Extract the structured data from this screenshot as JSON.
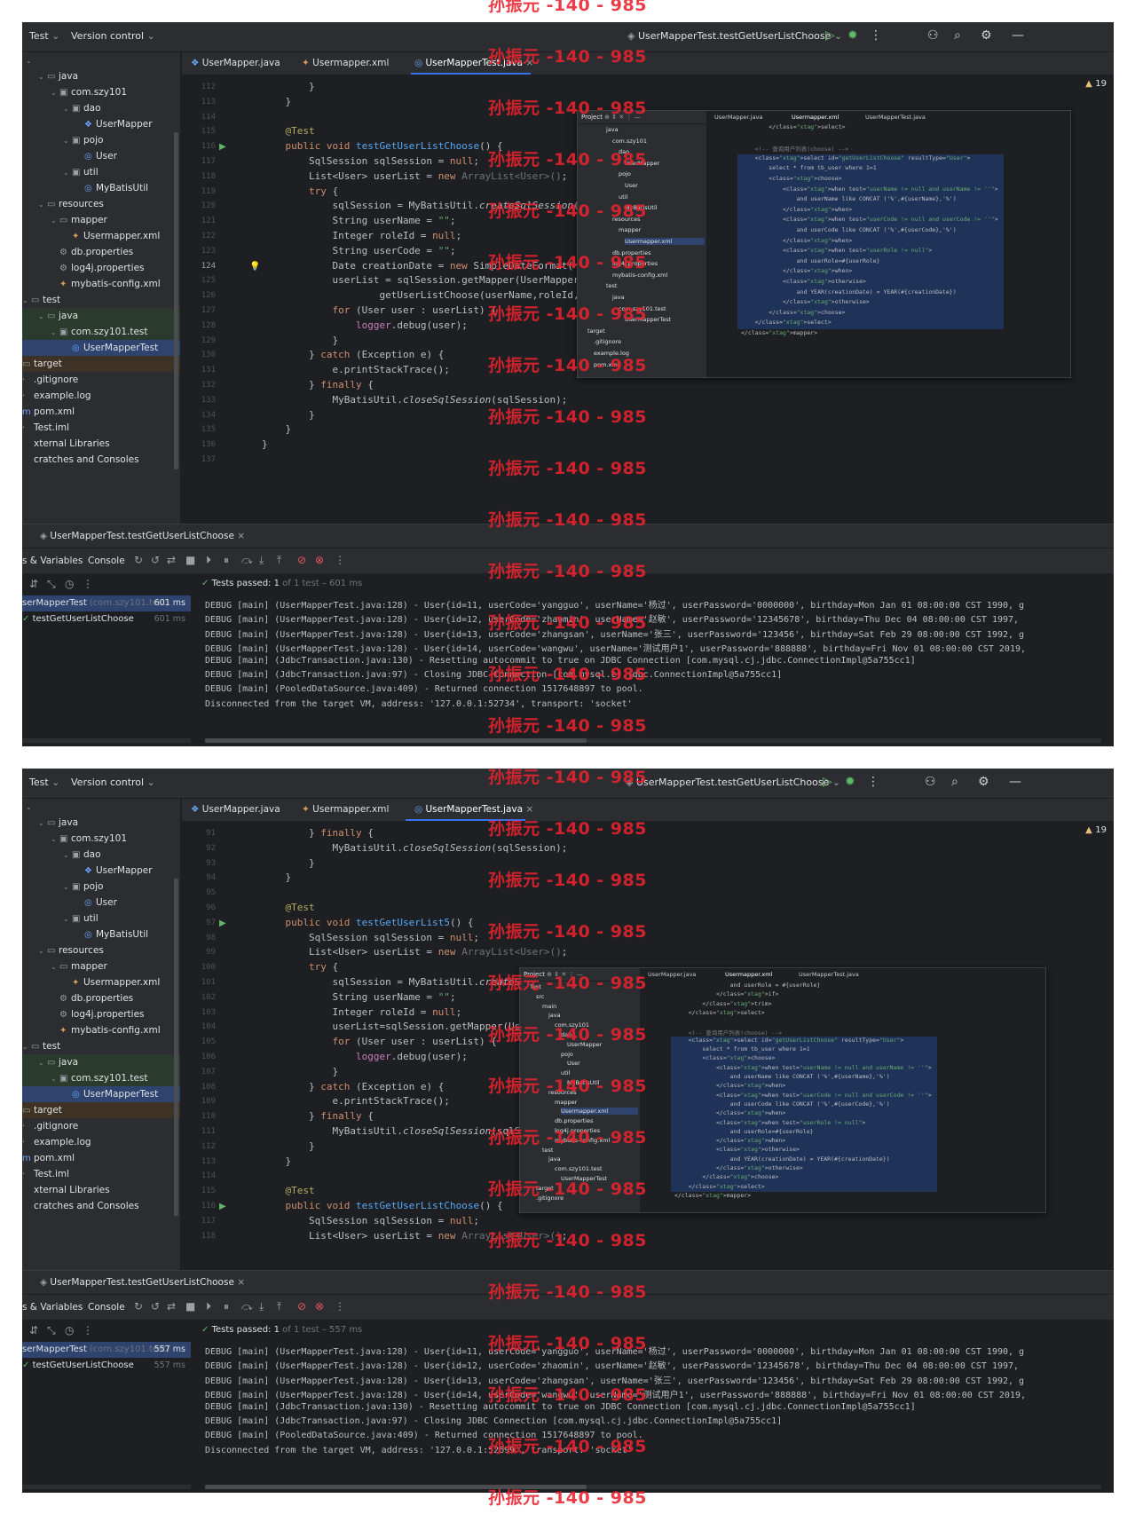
{
  "watermark": "孙振元 -140 - 985",
  "ide": {
    "project_dropdown": "Test",
    "vcs_dropdown": "Version control",
    "run_config": "UserMapperTest.testGetUserListChoose",
    "tabs": [
      "UserMapper.java",
      "Usermapper.xml",
      "UserMapperTest.java"
    ],
    "warnings": "19"
  },
  "tree": [
    {
      "label": "java",
      "icon": "folder"
    },
    {
      "label": "com.szy101",
      "icon": "package"
    },
    {
      "label": "dao",
      "icon": "package"
    },
    {
      "label": "UserMapper",
      "icon": "interface"
    },
    {
      "label": "pojo",
      "icon": "package"
    },
    {
      "label": "User",
      "icon": "class"
    },
    {
      "label": "util",
      "icon": "package"
    },
    {
      "label": "MyBatisUtil",
      "icon": "class"
    },
    {
      "label": "resources",
      "icon": "folder"
    },
    {
      "label": "mapper",
      "icon": "folder"
    },
    {
      "label": "Usermapper.xml",
      "icon": "xml"
    },
    {
      "label": "db.properties",
      "icon": "properties"
    },
    {
      "label": "log4j.properties",
      "icon": "properties"
    },
    {
      "label": "mybatis-config.xml",
      "icon": "xml"
    },
    {
      "label": "test",
      "icon": "folder"
    },
    {
      "label": "java",
      "icon": "folder"
    },
    {
      "label": "com.szy101.test",
      "icon": "package"
    },
    {
      "label": "UserMapperTest",
      "icon": "class"
    },
    {
      "label": "target",
      "icon": "folder"
    },
    {
      "label": ".gitignore",
      "icon": "file"
    },
    {
      "label": "example.log",
      "icon": "file"
    },
    {
      "label": "pom.xml",
      "icon": "maven"
    },
    {
      "label": "Test.iml",
      "icon": "file"
    },
    {
      "label": "xternal Libraries",
      "icon": "library"
    },
    {
      "label": "cratches and Consoles",
      "icon": "scratch"
    }
  ],
  "panel": {
    "run_title": "UserMapperTest.testGetUserListChoose",
    "vars_tab": "s & Variables",
    "console_tab": "Console",
    "passed_label": "Tests passed: 1",
    "test_class": "serMapperTest",
    "test_pkg": "(com.szy101.test)",
    "test_method": "testGetUserListChoose"
  },
  "inset": {
    "project_label": "Project",
    "tabs": [
      "UserMapper.java",
      "Usermapper.xml",
      "UserMapperTest.java"
    ],
    "tree_top": [
      "java",
      "com.szy101",
      "dao",
      "UserMapper",
      "pojo",
      "User",
      "util",
      "MyBatisUtil",
      "resources",
      "mapper",
      "Usermapper.xml",
      "db.properties",
      "log4j.properties",
      "mybatis-config.xml",
      "test",
      "java",
      "com.szy101.test",
      "UserMapperTest",
      "target",
      ".gitignore",
      "example.log",
      "pom.xml"
    ],
    "tree_bottom_top": [
      "Test",
      "src",
      "main",
      "java",
      "com.szy101",
      "dao",
      "UserMapper",
      "pojo",
      "User",
      "util",
      "MyBatisUtil",
      "resources",
      "mapper",
      "Usermapper.xml",
      "db.properties",
      "log4j.properties",
      "mybatis-config.xml",
      "test",
      "java",
      "com.szy101.test",
      "UserMapperTest",
      "target",
      ".gitignore"
    ]
  },
  "shots": [
    {
      "gutter": [
        "112",
        "113",
        "114",
        "115",
        "116",
        "117",
        "118",
        "119",
        "120",
        "121",
        "122",
        "123",
        "124",
        "125",
        "126",
        "127",
        "128",
        "129",
        "130",
        "131",
        "132",
        "133",
        "134",
        "135",
        "136",
        "137"
      ],
      "current_line": "124",
      "code": [
        "        }",
        "    }",
        "",
        "    @Test",
        "    public void testGetUserListChoose() {",
        "        SqlSession sqlSession = null;",
        "        List<User> userList = new ArrayList<User>();",
        "        try {",
        "            sqlSession = MyBatisUtil.createSqlSession();",
        "            String userName = \"\";",
        "            Integer roleId = null;",
        "            String userCode = \"\";",
        "            Date creationDate = new SimpleDateFormat( pattern: \"y",
        "            userList = sqlSession.getMapper(UserMapper.class).",
        "                    getUserListChoose(userName,roleId,userCode",
        "            for (User user : userList) {",
        "                logger.debug(user);",
        "            }",
        "        } catch (Exception e) {",
        "            e.printStackTrace();",
        "        } finally {",
        "            MyBatisUtil.closeSqlSession(sqlSession);",
        "        }",
        "    }",
        "}",
        ""
      ],
      "test_ms": "601 ms",
      "passed_suffix": " of 1 test – 601 ms",
      "console": [
        "DEBUG [main] (UserMapperTest.java:128) - User{id=11, userCode='yangguo', userName='杨过', userPassword='0000000', birthday=Mon Jan 01 08:00:00 CST 1990, g",
        "DEBUG [main] (UserMapperTest.java:128) - User{id=12, userCode='zhaomin', userName='赵敏', userPassword='12345678', birthday=Thu Dec 04 08:00:00 CST 1997, ",
        "DEBUG [main] (UserMapperTest.java:128) - User{id=13, userCode='zhangsan', userName='张三', userPassword='123456', birthday=Sat Feb 29 08:00:00 CST 1992, g",
        "DEBUG [main] (UserMapperTest.java:128) - User{id=14, userCode='wangwu', userName='测试用户1', userPassword='888888', birthday=Fri Nov 01 08:00:00 CST 2019,",
        "DEBUG [main] (JdbcTransaction.java:130) - Resetting autocommit to true on JDBC Connection [com.mysql.cj.jdbc.ConnectionImpl@5a755cc1]",
        "DEBUG [main] (JdbcTransaction.java:97) - Closing JDBC Connection [com.mysql.cj.jdbc.ConnectionImpl@5a755cc1]",
        "DEBUG [main] (PooledDataSource.java:409) - Returned connection 1517648897 to pool.",
        "Disconnected from the target VM, address: '127.0.0.1:52734', transport: 'socket'"
      ]
    },
    {
      "gutter": [
        "91",
        "92",
        "93",
        "94",
        "95",
        "96",
        "97",
        "98",
        "99",
        "100",
        "101",
        "102",
        "103",
        "104",
        "105",
        "106",
        "107",
        "108",
        "109",
        "110",
        "111",
        "112",
        "113",
        "114",
        "115",
        "116",
        "117",
        "118"
      ],
      "current_line": "",
      "code": [
        "        } finally {",
        "            MyBatisUtil.closeSqlSession(sqlSession);",
        "        }",
        "    }",
        "",
        "    @Test",
        "    public void testGetUserList5() {",
        "        SqlSession sqlSession = null;",
        "        List<User> userList = new ArrayList<User>();",
        "        try {",
        "            sqlSession = MyBatisUtil.createSqlSessio",
        "            String userName = \"\";",
        "            Integer roleId = null;",
        "            userList=sqlSession.getMapper(UserMapper",
        "            for (User user : userList) {",
        "                logger.debug(user);",
        "            }",
        "        } catch (Exception e) {",
        "            e.printStackTrace();",
        "        } finally {",
        "            MyBatisUtil.closeSqlSession(sqlSession);",
        "        }",
        "    }",
        "",
        "    @Test",
        "    public void testGetUserListChoose() {",
        "        SqlSession sqlSession = null;",
        "        List<User> userList = new ArrayList<User>();"
      ],
      "test_ms": "557 ms",
      "passed_suffix": " of 1 test – 557 ms",
      "console": [
        "DEBUG [main] (UserMapperTest.java:128) - User{id=11, userCode='yangguo', userName='杨过', userPassword='0000000', birthday=Mon Jan 01 08:00:00 CST 1990, g",
        "DEBUG [main] (UserMapperTest.java:128) - User{id=12, userCode='zhaomin', userName='赵敏', userPassword='12345678', birthday=Thu Dec 04 08:00:00 CST 1997, ",
        "DEBUG [main] (UserMapperTest.java:128) - User{id=13, userCode='zhangsan', userName='张三', userPassword='123456', birthday=Sat Feb 29 08:00:00 CST 1992, g",
        "DEBUG [main] (UserMapperTest.java:128) - User{id=14, userCode='wangwu', userName='测试用户1', userPassword='888888', birthday=Fri Nov 01 08:00:00 CST 2019,",
        "DEBUG [main] (JdbcTransaction.java:130) - Resetting autocommit to true on JDBC Connection [com.mysql.cj.jdbc.ConnectionImpl@5a755cc1]",
        "DEBUG [main] (JdbcTransaction.java:97) - Closing JDBC Connection [com.mysql.cj.jdbc.ConnectionImpl@5a755cc1]",
        "DEBUG [main] (PooledDataSource.java:409) - Returned connection 1517648897 to pool.",
        "Disconnected from the target VM, address: '127.0.0.1:52699', transport: 'socket'"
      ]
    }
  ],
  "xml": {
    "top": [
      "        </select>",
      "",
      "    <!-- 查询用户列表(choose) -->",
      "    <select id=\"getUserListChoose\" resultType=\"User\">",
      "        select * from tb_user where 1=1",
      "        <choose>",
      "            <when test=\"userName != null and userName != ''\">",
      "                and userName like CONCAT ('%',#{userName},'%')",
      "            </when>",
      "            <when test=\"userCode != null and userCode != ''\">",
      "                and userCode like CONCAT ('%',#{userCode},'%')",
      "            </when>",
      "            <when test=\"userRole != null\">",
      "                and userRole=#{userRole}",
      "            </when>",
      "            <otherwise>",
      "                and YEAR(creationDate) = YEAR(#{creationDate})",
      "            </otherwise>",
      "        </choose>",
      "    </select>",
      "</mapper>"
    ],
    "bottom": [
      "                and userRole = #{userRole}",
      "            </if>",
      "        </trim>",
      "    </select>",
      "",
      "    <!-- 查询用户列表(choose) -->",
      "    <select id=\"getUserListChoose\" resultType=\"User\">",
      "        select * from tb_user where 1=1",
      "        <choose>",
      "            <when test=\"userName != null and userName != ''\">",
      "                and userName like CONCAT ('%',#{userName},'%')",
      "            </when>",
      "            <when test=\"userCode != null and userCode != ''\">",
      "                and userCode like CONCAT ('%',#{userCode},'%')",
      "            </when>",
      "            <when test=\"userRole != null\">",
      "                and userRole=#{userRole}",
      "            </when>",
      "            <otherwise>",
      "                and YEAR(creationDate) = YEAR(#{creationDate})",
      "            </otherwise>",
      "        </choose>",
      "    </select>",
      "</mapper>"
    ]
  },
  "colors": {
    "accent": "#3574f0",
    "pass_green": "#5fb865",
    "watermark": "#e8232f",
    "bg": "#1e1f22",
    "panel": "#2b2d30"
  }
}
